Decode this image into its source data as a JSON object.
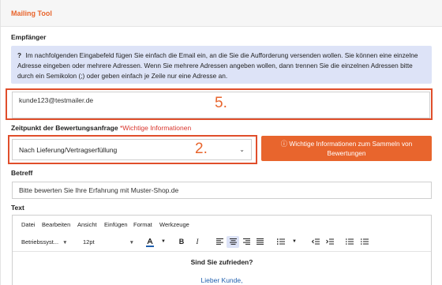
{
  "header": {
    "title": "Mailing Tool"
  },
  "recipient": {
    "label": "Empfänger",
    "info_icon": "?",
    "info_text": "Im nachfolgenden Eingabefeld fügen Sie einfach die Email ein, an die Sie die Aufforderung versenden wollen. Sie können eine einzelne Adresse eingeben oder mehrere Adressen. Wenn Sie mehrere Adressen angeben wollen, dann trennen Sie die einzelnen Adressen bitte durch ein Semikolon (;) oder geben einfach je Zeile nur eine Adresse an.",
    "email_value": "kunde123@testmailer.de",
    "step_number": "5."
  },
  "timing": {
    "label": "Zeitpunkt der Bewertungsanfrage",
    "required_note": "*Wichtige Informationen",
    "selected": "Nach Lieferung/Vertragserfüllung",
    "step_number": "2.",
    "info_button": "Wichtige Informationen zum Sammeln von Bewertungen"
  },
  "subject": {
    "label": "Betreff",
    "value": "Bitte bewerten Sie Ihre Erfahrung mit Muster-Shop.de"
  },
  "text": {
    "label": "Text",
    "menu": [
      "Datei",
      "Bearbeiten",
      "Ansicht",
      "Einfügen",
      "Format",
      "Werkzeuge"
    ],
    "font_family": "Betriebssyst...",
    "font_size": "12pt",
    "content_heading": "Sind Sie zufrieden?",
    "content_greeting": "Lieber Kunde,"
  },
  "colors": {
    "accent": "#e8652d",
    "highlight": "#e04e2b",
    "info_bg": "#dde3f7",
    "link": "#1f5fae"
  }
}
